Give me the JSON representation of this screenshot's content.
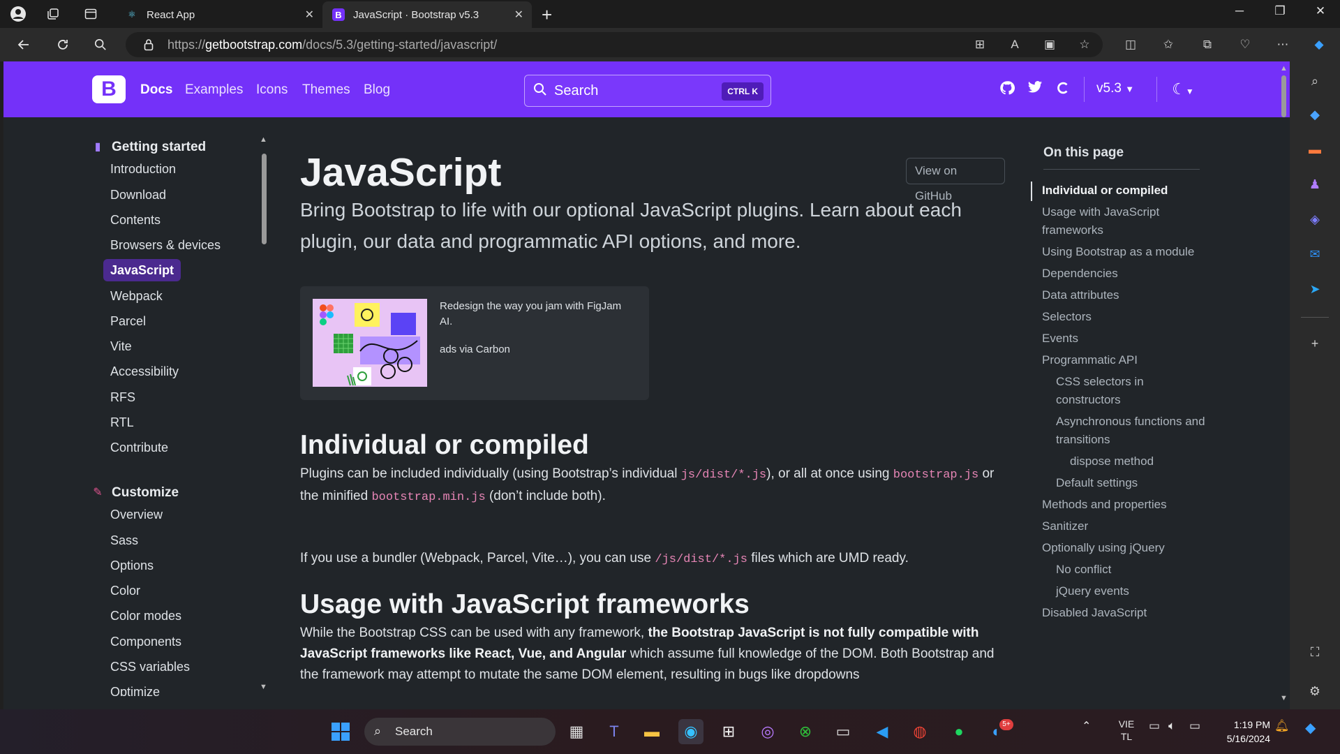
{
  "browser": {
    "tabs": [
      {
        "title": "React App",
        "favicon": "react-icon"
      },
      {
        "title": "JavaScript · Bootstrap v5.3",
        "favicon": "B",
        "active": true
      }
    ],
    "url_prefix": "https://",
    "url_host": "getbootstrap.com",
    "url_path": "/docs/5.3/getting-started/javascript/"
  },
  "bootstrap_nav": {
    "logo": "B",
    "links": [
      "Docs",
      "Examples",
      "Icons",
      "Themes",
      "Blog"
    ],
    "search_placeholder": "Search",
    "search_shortcut": "CTRL K",
    "version": "v5.3",
    "brand_color": "#7431f9"
  },
  "sidebar": {
    "groups": [
      {
        "title": "Getting started",
        "items": [
          "Introduction",
          "Download",
          "Contents",
          "Browsers & devices",
          "JavaScript",
          "Webpack",
          "Parcel",
          "Vite",
          "Accessibility",
          "RFS",
          "RTL",
          "Contribute"
        ]
      },
      {
        "title": "Customize",
        "items": [
          "Overview",
          "Sass",
          "Options",
          "Color",
          "Color modes",
          "Components",
          "CSS variables",
          "Optimize"
        ]
      }
    ],
    "active_item": "JavaScript"
  },
  "main": {
    "title": "JavaScript",
    "lead": "Bring Bootstrap to life with our optional JavaScript plugins. Learn about each plugin, our data and programmatic API options, and more.",
    "github_button": "View on GitHub",
    "ad": {
      "text": "Redesign the way you jam with FigJam AI.",
      "source": "ads via Carbon"
    },
    "section1": {
      "heading": "Individual or compiled",
      "p1_a": "Plugins can be included individually (using Bootstrap’s individual ",
      "p1_code1": "js/dist/*.js",
      "p1_b": "), or all at once using ",
      "p1_code2": "bootstrap.js",
      "p1_c": " or the minified ",
      "p1_code3": "bootstrap.min.js",
      "p1_d": " (don’t include both).",
      "p2_a": "If you use a bundler (Webpack, Parcel, Vite…), you can use ",
      "p2_code": "/js/dist/*.js",
      "p2_b": " files which are UMD ready."
    },
    "section2": {
      "heading": "Usage with JavaScript frameworks",
      "p_a": "While the Bootstrap CSS can be used with any framework, ",
      "p_bold": "the Bootstrap JavaScript is not fully compatible with JavaScript frameworks like React, Vue, and Angular",
      "p_b": " which assume full knowledge of the DOM. Both Bootstrap and the framework may attempt to mutate the same DOM element, resulting in bugs like dropdowns"
    }
  },
  "toc": {
    "heading": "On this page",
    "items": [
      {
        "label": "Individual or compiled",
        "level": 0,
        "active": true
      },
      {
        "label": "Usage with JavaScript frameworks",
        "level": 0
      },
      {
        "label": "Using Bootstrap as a module",
        "level": 0
      },
      {
        "label": "Dependencies",
        "level": 0
      },
      {
        "label": "Data attributes",
        "level": 0
      },
      {
        "label": "Selectors",
        "level": 0
      },
      {
        "label": "Events",
        "level": 0
      },
      {
        "label": "Programmatic API",
        "level": 0
      },
      {
        "label": "CSS selectors in constructors",
        "level": 1
      },
      {
        "label": "Asynchronous functions and transitions",
        "level": 1
      },
      {
        "label": "dispose method",
        "level": 2
      },
      {
        "label": "Default settings",
        "level": 1
      },
      {
        "label": "Methods and properties",
        "level": 0
      },
      {
        "label": "Sanitizer",
        "level": 0
      },
      {
        "label": "Optionally using jQuery",
        "level": 0
      },
      {
        "label": "No conflict",
        "level": 1
      },
      {
        "label": "jQuery events",
        "level": 1
      },
      {
        "label": "Disabled JavaScript",
        "level": 0
      }
    ]
  },
  "taskbar": {
    "search_placeholder": "Search",
    "language": "VIE",
    "language_sub": "TL",
    "time": "1:19 PM",
    "date": "5/16/2024",
    "zalo_badge": "5+"
  }
}
